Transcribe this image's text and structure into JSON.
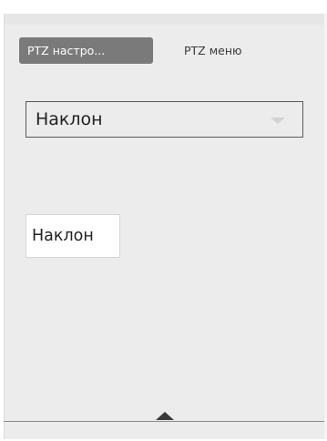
{
  "tabs": [
    {
      "label": "PTZ настро...",
      "active": true
    },
    {
      "label": "PTZ меню",
      "active": false
    }
  ],
  "select": {
    "value": "Наклон"
  },
  "label_box": {
    "text": "Наклон"
  },
  "icons": {
    "select_arrow": "chevron-down-icon",
    "collapse_arrow": "triangle-up-icon"
  },
  "colors": {
    "active_tab_bg": "#7a7a7a",
    "panel_bg": "#ececec"
  }
}
